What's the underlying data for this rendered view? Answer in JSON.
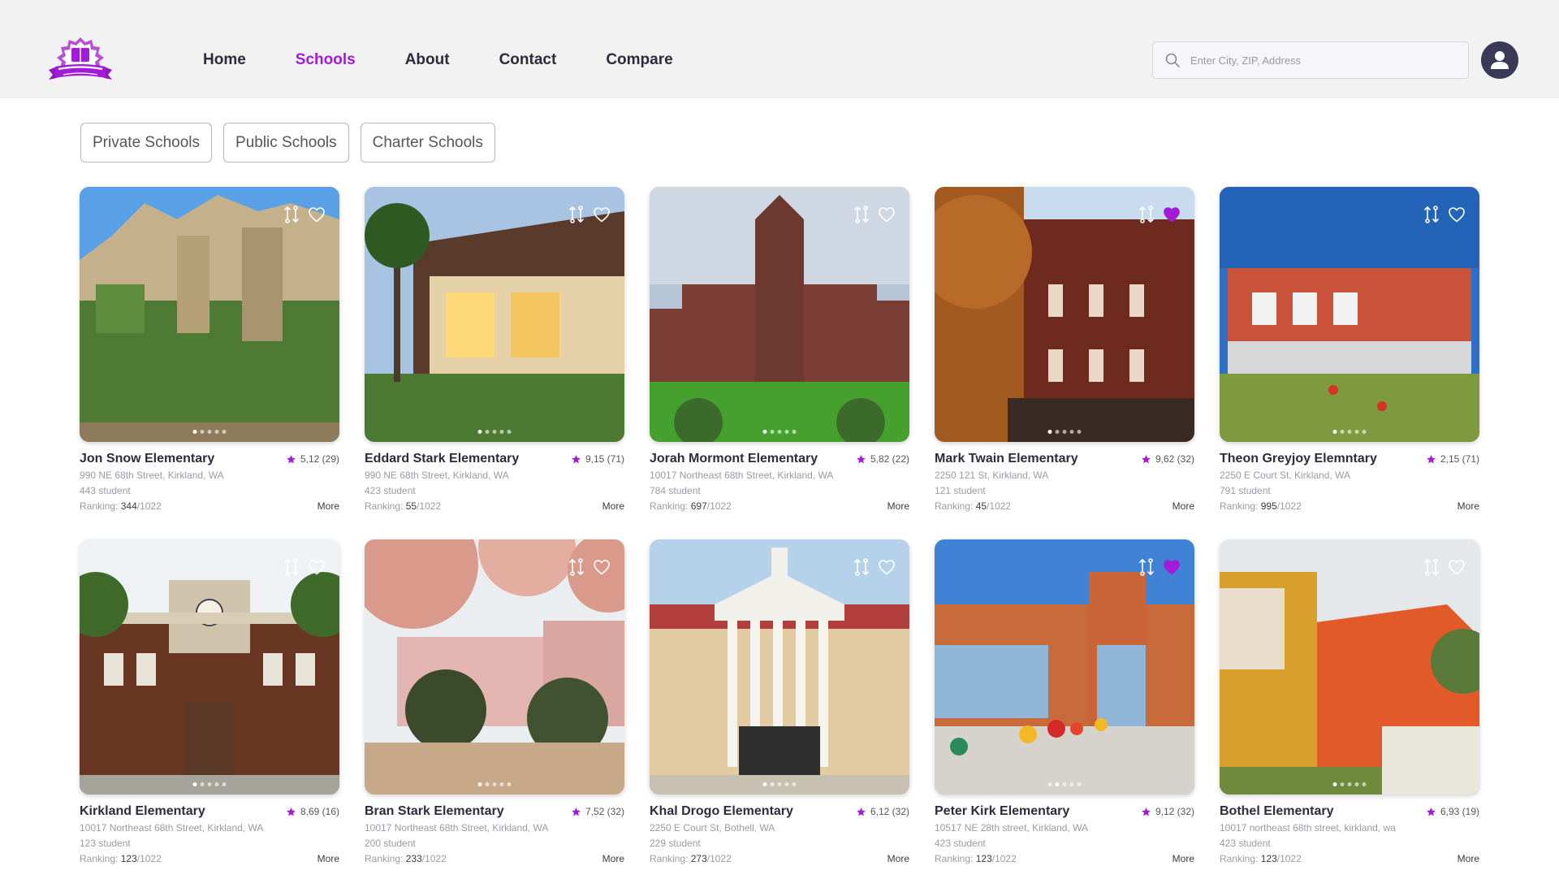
{
  "nav": {
    "items": [
      {
        "label": "Home",
        "active": false
      },
      {
        "label": "Schools",
        "active": true
      },
      {
        "label": "About",
        "active": false
      },
      {
        "label": "Contact",
        "active": false
      },
      {
        "label": "Compare",
        "active": false
      }
    ]
  },
  "search": {
    "placeholder": "Enter City, ZIP, Address",
    "value": ""
  },
  "filters": [
    "Private Schools",
    "Public Schools",
    "Charter Schools"
  ],
  "colors": {
    "accent": "#a21cd8",
    "header_bg": "#f2f2f3",
    "avatar_bg": "#3a3a58",
    "star": "#a21cd8"
  },
  "schools": [
    {
      "name": "Jon Snow Elementary",
      "rating": "5,12",
      "reviews": "(29)",
      "address": "990  NE 68th Street, Kirkland, WA",
      "students": "443 student",
      "ranking_label": "Ranking:",
      "rank": "344",
      "rank_total": "/1022",
      "more": "More",
      "favorite": false,
      "scene": "gothic-ivy",
      "active_dot": 0
    },
    {
      "name": "Eddard Stark Elementary",
      "rating": "9,15",
      "reviews": "(71)",
      "address": "990  NE 68th Street, Kirkland, WA",
      "students": "423 student",
      "ranking_label": "Ranking:",
      "rank": "55",
      "rank_total": "/1022",
      "more": "More",
      "favorite": false,
      "scene": "modern-night",
      "active_dot": 0
    },
    {
      "name": "Jorah Mormont Elementary",
      "rating": "5,82",
      "reviews": "(22)",
      "address": "10017 Northeast 68th Street, Kirkland, WA",
      "students": "784 student",
      "ranking_label": "Ranking:",
      "rank": "697",
      "rank_total": "/1022",
      "more": "More",
      "favorite": false,
      "scene": "gothic-castle",
      "active_dot": 0
    },
    {
      "name": "Mark Twain Elementary",
      "rating": "9,62",
      "reviews": "(32)",
      "address": "2250 121 St, Kirkland, WA",
      "students": "121 student",
      "ranking_label": "Ranking:",
      "rank": "45",
      "rank_total": "/1022",
      "more": "More",
      "favorite": true,
      "scene": "red-brick",
      "active_dot": 0
    },
    {
      "name": "Theon Greyjoy Elemntary",
      "rating": "2,15",
      "reviews": "(71)",
      "address": "2250 E Court St, Kirkland, WA",
      "students": "791 student",
      "ranking_label": "Ranking:",
      "rank": "995",
      "rank_total": "/1022",
      "more": "More",
      "favorite": false,
      "scene": "modern-red",
      "active_dot": 0
    },
    {
      "name": "Kirkland Elementary",
      "rating": "8,69",
      "reviews": "(16)",
      "address": "10017 Northeast 68th Street, Kirkland, WA",
      "students": "123 student",
      "ranking_label": "Ranking:",
      "rank": "123",
      "rank_total": "/1022",
      "more": "More",
      "favorite": false,
      "scene": "clock-brick",
      "active_dot": 0
    },
    {
      "name": "Bran Stark Elementary",
      "rating": "7,52",
      "reviews": "(32)",
      "address": "10017 Northeast 68th Street, Kirkland, WA",
      "students": "200 student",
      "ranking_label": "Ranking:",
      "rank": "233",
      "rank_total": "/1022",
      "more": "More",
      "favorite": false,
      "scene": "blossom-campus",
      "active_dot": 0
    },
    {
      "name": "Khal Drogo Elementary",
      "rating": "6,12",
      "reviews": "(32)",
      "address": "2250 E Court St, Bothell, WA",
      "students": "229 student",
      "ranking_label": "Ranking:",
      "rank": "273",
      "rank_total": "/1022",
      "more": "More",
      "favorite": false,
      "scene": "columns-hall",
      "active_dot": 0
    },
    {
      "name": "Peter Kirk Elementary",
      "rating": "9,12",
      "reviews": "(32)",
      "address": "10517 NE 28th street, Kirkland, WA",
      "students": "423 student",
      "ranking_label": "Ranking:",
      "rank": "123",
      "rank_total": "/1022",
      "more": "More",
      "favorite": true,
      "scene": "modern-balls",
      "active_dot": 1
    },
    {
      "name": "Bothel Elementary",
      "rating": "6,93",
      "reviews": "(19)",
      "address": "10017 northeast 68th street, kirkland, wa",
      "students": "423 student",
      "ranking_label": "Ranking:",
      "rank": "123",
      "rank_total": "/1022",
      "more": "More",
      "favorite": false,
      "scene": "orange-modern",
      "active_dot": 0
    }
  ]
}
